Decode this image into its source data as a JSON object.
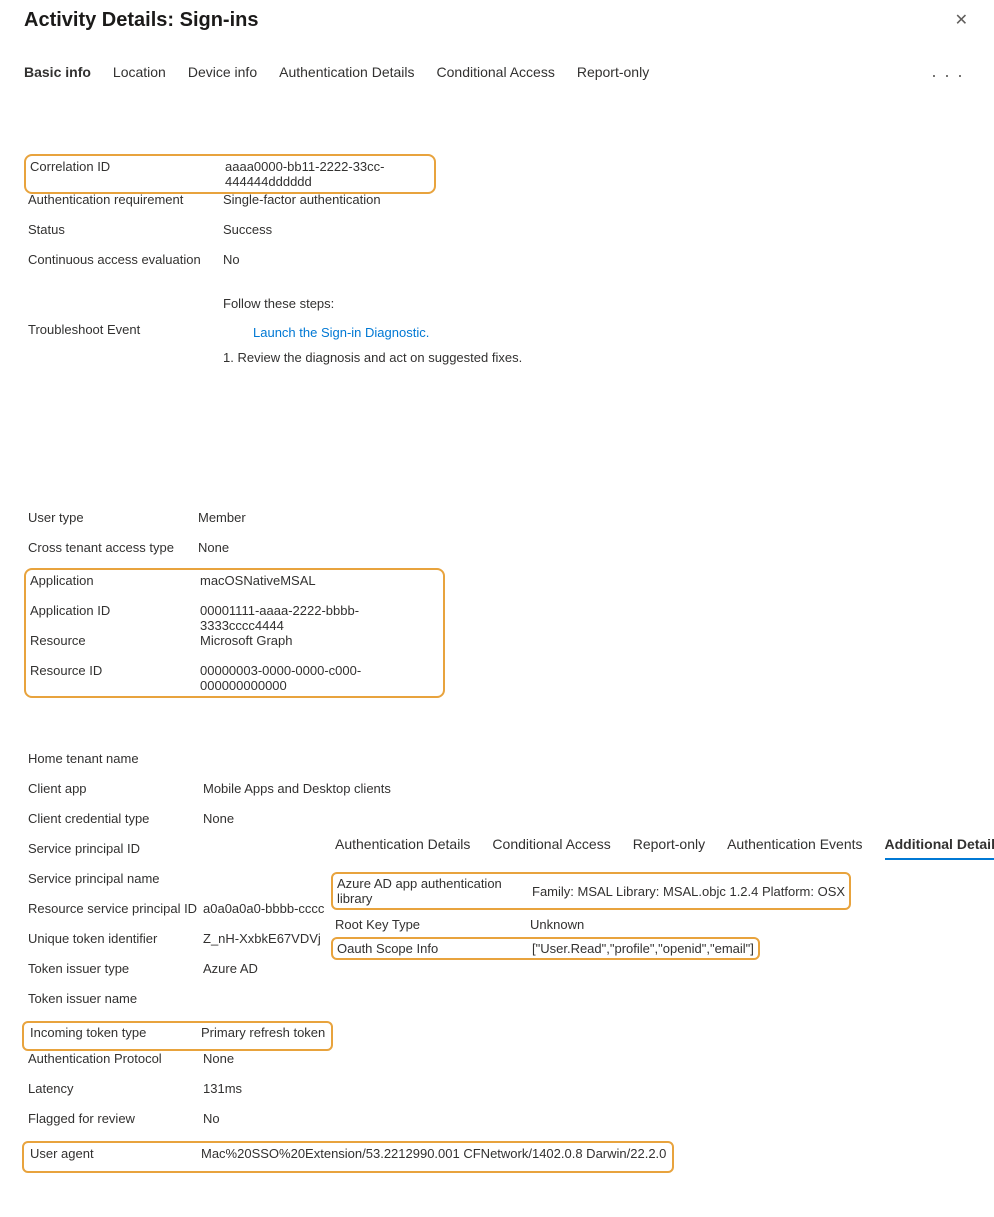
{
  "header": {
    "title": "Activity Details: Sign-ins"
  },
  "tabs": {
    "basic": "Basic info",
    "location": "Location",
    "device": "Device info",
    "auth": "Authentication Details",
    "cond": "Conditional Access",
    "report": "Report-only"
  },
  "block1": {
    "correlation_id_label": "Correlation ID",
    "correlation_id_value": "aaaa0000-bb11-2222-33cc-444444dddddd",
    "auth_req_label": "Authentication requirement",
    "auth_req_value": "Single-factor authentication",
    "status_label": "Status",
    "status_value": "Success",
    "cae_label": "Continuous access evaluation",
    "cae_value": "No",
    "troubleshoot_label": "Troubleshoot Event",
    "follow_steps": "Follow these steps:",
    "launch_link": "Launch the Sign-in Diagnostic.",
    "review_step": "1. Review the diagnosis and act on suggested fixes."
  },
  "block2": {
    "user_type_label": "User type",
    "user_type_value": "Member",
    "cross_tenant_label": "Cross tenant access type",
    "cross_tenant_value": "None",
    "app_label": "Application",
    "app_value": "macOSNativeMSAL",
    "app_id_label": "Application ID",
    "app_id_value": "00001111-aaaa-2222-bbbb-3333cccc4444",
    "resource_label": "Resource",
    "resource_value": "Microsoft Graph",
    "resource_id_label": "Resource ID",
    "resource_id_value": "00000003-0000-0000-c000-000000000000"
  },
  "block3": {
    "home_tenant_label": "Home tenant name",
    "client_app_label": "Client app",
    "client_app_value": "Mobile Apps and Desktop clients",
    "client_cred_label": "Client credential type",
    "client_cred_value": "None",
    "sp_id_label": "Service principal ID",
    "sp_name_label": "Service principal name",
    "rsp_id_label": "Resource service principal ID",
    "rsp_id_value": "a0a0a0a0-bbbb-cccc",
    "uti_label": "Unique token identifier",
    "uti_value": "Z_nH-XxbkE67VDVj",
    "issuer_type_label": "Token issuer type",
    "issuer_type_value": "Azure AD",
    "issuer_name_label": "Token issuer name",
    "incoming_label": "Incoming token type",
    "incoming_value": "Primary refresh token",
    "auth_proto_label": "Authentication Protocol",
    "auth_proto_value": "None",
    "latency_label": "Latency",
    "latency_value": "131ms",
    "flagged_label": "Flagged for review",
    "flagged_value": "No",
    "ua_label": "User agent",
    "ua_value": "Mac%20SSO%20Extension/53.2212990.001 CFNetwork/1402.0.8 Darwin/22.2.0"
  },
  "side_tabs": {
    "auth": "Authentication Details",
    "cond": "Conditional Access",
    "report": "Report-only",
    "events": "Authentication Events",
    "additional": "Additional Details"
  },
  "side": {
    "lib_label": "Azure AD app authentication library",
    "lib_value": "Family: MSAL Library: MSAL.objc 1.2.4 Platform: OSX",
    "rkt_label": "Root Key Type",
    "rkt_value": "Unknown",
    "scope_label": "Oauth Scope Info",
    "scope_value": "[\"User.Read\",\"profile\",\"openid\",\"email\"]"
  }
}
